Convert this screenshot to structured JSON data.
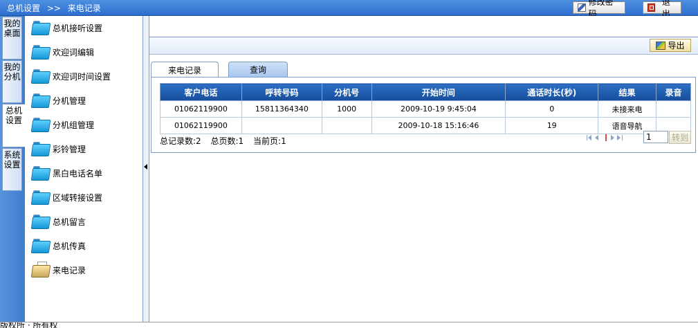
{
  "header": {
    "breadcrumb": [
      "总机设置",
      ">>",
      "来电记录"
    ],
    "change_password": "修改密码",
    "logout": "退出"
  },
  "vtabs": [
    {
      "label": "我的桌面",
      "active": false
    },
    {
      "label": "我的分机",
      "active": false
    },
    {
      "label": "总机设置",
      "active": true
    },
    {
      "label": "系统设置",
      "active": false
    }
  ],
  "menu": [
    "总机接听设置",
    "欢迎词编辑",
    "欢迎词时间设置",
    "分机管理",
    "分机组管理",
    "彩铃管理",
    "黑白电话名单",
    "区域转接设置",
    "总机留言",
    "总机传真",
    "来电记录"
  ],
  "toolbar": {
    "export": "导出"
  },
  "tabs": [
    {
      "label": "来电记录",
      "active": true
    },
    {
      "label": "查询",
      "active": false
    }
  ],
  "table": {
    "columns": [
      "客户电话",
      "呼转号码",
      "分机号",
      "开始时间",
      "通话时长(秒)",
      "结果",
      "录音"
    ],
    "rows": [
      [
        "01062119900",
        "15811364340",
        "1000",
        "2009-10-19 9:45:04",
        "0",
        "未接来电",
        ""
      ],
      [
        "01062119900",
        "",
        "",
        "2009-10-18 15:16:46",
        "19",
        "语音导航",
        ""
      ]
    ]
  },
  "summary": {
    "total_records": "总记录数:2",
    "total_pages": "总页数:1",
    "current_page": "当前页:1"
  },
  "pager": {
    "page_value": "1",
    "go": "转到"
  },
  "status": {
    "text": "版权所 · 所有权"
  },
  "colors": {
    "accent": "#2e6fcf",
    "header_row": "#174e9c"
  }
}
